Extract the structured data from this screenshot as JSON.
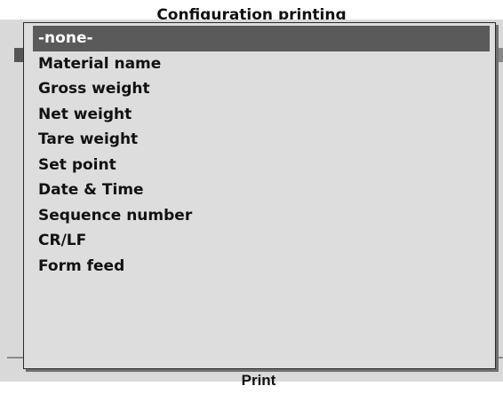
{
  "dialog": {
    "title": "Configuration printing",
    "print_label": "Print"
  },
  "popup": {
    "selected_index": 0,
    "items": [
      {
        "label": "-none-"
      },
      {
        "label": "Material name"
      },
      {
        "label": "Gross weight"
      },
      {
        "label": "Net weight"
      },
      {
        "label": "Tare weight"
      },
      {
        "label": "Set point"
      },
      {
        "label": "Date & Time"
      },
      {
        "label": "Sequence number"
      },
      {
        "label": "CR/LF"
      },
      {
        "label": "Form feed"
      }
    ]
  }
}
